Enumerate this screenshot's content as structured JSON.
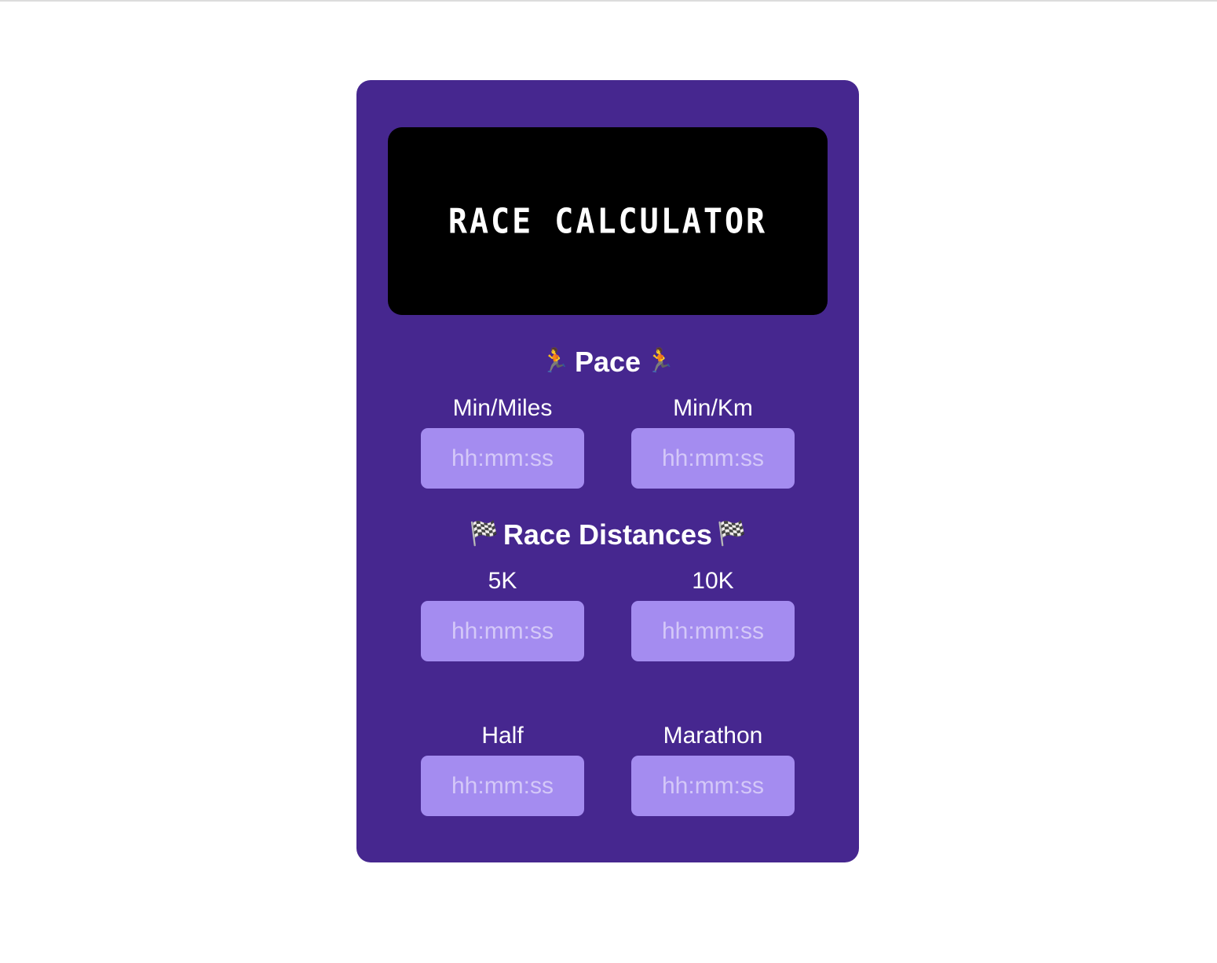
{
  "app": {
    "title": "RACE CALCULATOR"
  },
  "pace": {
    "heading": "Pace",
    "heading_emoji": "🏃",
    "fields": [
      {
        "label": "Min/Miles",
        "placeholder": "hh:mm:ss",
        "value": ""
      },
      {
        "label": "Min/Km",
        "placeholder": "hh:mm:ss",
        "value": ""
      }
    ]
  },
  "distances": {
    "heading": "Race Distances",
    "heading_emoji": "🏁",
    "fields": [
      {
        "label": "5K",
        "placeholder": "hh:mm:ss",
        "value": ""
      },
      {
        "label": "10K",
        "placeholder": "hh:mm:ss",
        "value": ""
      },
      {
        "label": "Half",
        "placeholder": "hh:mm:ss",
        "value": ""
      },
      {
        "label": "Marathon",
        "placeholder": "hh:mm:ss",
        "value": ""
      }
    ]
  },
  "colors": {
    "card": "#46278f",
    "display": "#000000",
    "input": "#a48cf0",
    "placeholder": "#d4c8f8"
  }
}
